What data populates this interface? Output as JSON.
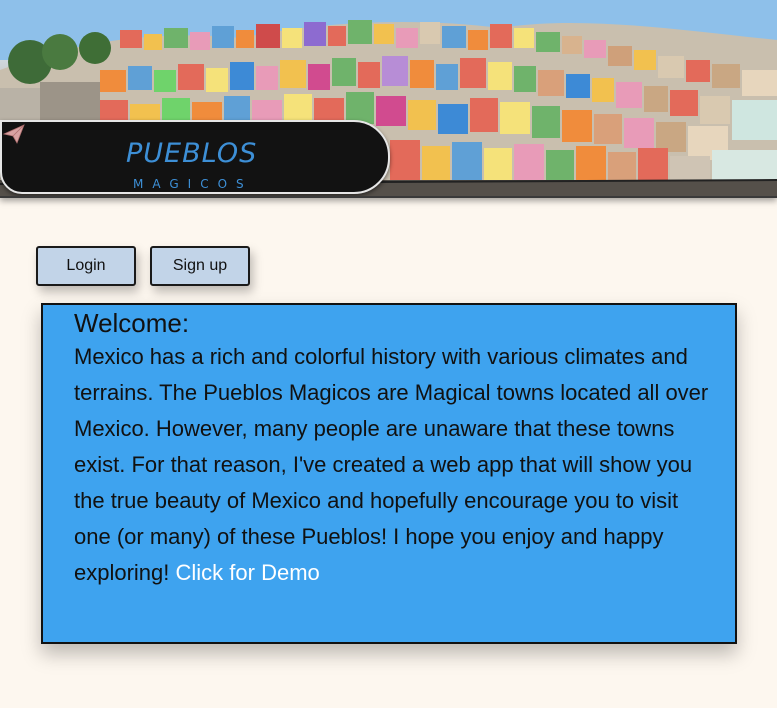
{
  "header": {
    "logo_title": "PUEBLOS",
    "logo_subtitle": "MAGICOS",
    "logo_icon": "paper-plane-icon",
    "banner_image": "colorful-hillside-town-photo"
  },
  "auth": {
    "login_label": "Login",
    "signup_label": "Sign up"
  },
  "welcome": {
    "title": "Welcome:",
    "body": "Mexico has a rich and colorful history with various climates and terrains. The Pueblos Magicos are Magical towns located all over Mexico. However, many people are unaware that these towns exist. For that reason, I've created a web app that will show you the true beauty of Mexico and hopefully encourage you to visit one (or many) of these Pueblos! I hope you enjoy and happy exploring!",
    "demo_link": "Click for Demo"
  },
  "colors": {
    "page_background": "#fdf7ef",
    "button_background": "#c2d4e8",
    "panel_background": "#3ea3ef",
    "logo_text": "#3d8fd6",
    "link_text": "#ffffff"
  }
}
